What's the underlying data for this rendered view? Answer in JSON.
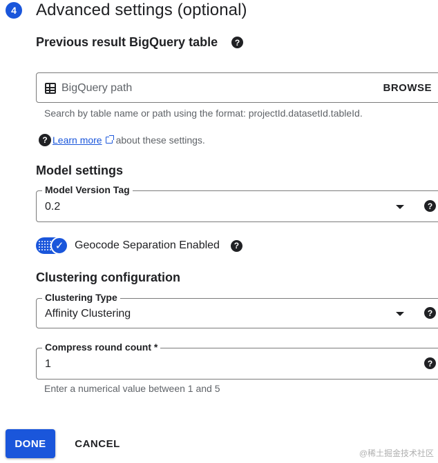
{
  "step": {
    "number": "4",
    "title": "Advanced settings (optional)"
  },
  "bigquery": {
    "section_label": "Previous result BigQuery table",
    "placeholder": "BigQuery path",
    "browse_label": "BROWSE",
    "hint": "Search by table name or path using the format: projectId.datasetId.tableId."
  },
  "learn_more": {
    "link_text": "Learn more",
    "suffix": "about these settings."
  },
  "model_settings": {
    "section_label": "Model settings",
    "version_tag": {
      "label": "Model Version Tag",
      "value": "0.2"
    },
    "geocode_toggle": {
      "label": "Geocode Separation Enabled",
      "enabled": true
    }
  },
  "clustering": {
    "section_label": "Clustering configuration",
    "type": {
      "label": "Clustering Type",
      "value": "Affinity Clustering"
    },
    "compress": {
      "label": "Compress round count *",
      "value": "1",
      "hint": "Enter a numerical value between 1 and 5"
    }
  },
  "footer": {
    "done_label": "DONE",
    "cancel_label": "CANCEL"
  },
  "watermark": "@稀土掘金技术社区",
  "icons": {
    "help": "?",
    "check": "✓",
    "dropdown": "triangle-down",
    "table": "table-icon",
    "external_link": "open-in-new-icon"
  },
  "colors": {
    "accent": "#1a56db",
    "text": "#202124",
    "muted": "#5f6368",
    "border": "#7a7a7a"
  }
}
